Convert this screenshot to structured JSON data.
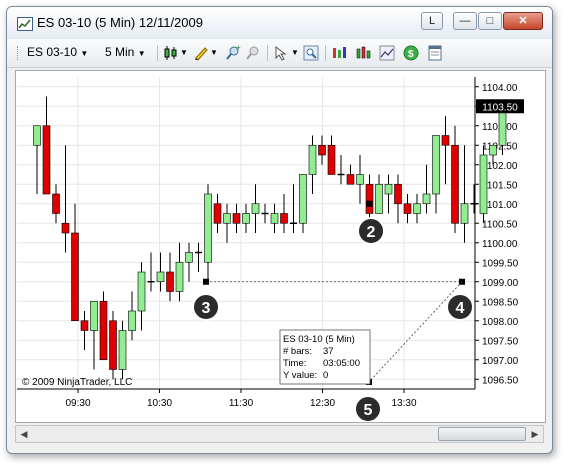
{
  "window": {
    "title": "ES 03-10 (5 Min)  12/11/2009",
    "controls": {
      "link": "L",
      "minimize": "—",
      "maximize": "□",
      "close": "✕"
    }
  },
  "toolbar": {
    "instrument": "ES 03-10",
    "interval": "5 Min",
    "icons": [
      "candlestick-icon",
      "pencil-icon",
      "zoom-in-icon",
      "zoom-out-icon",
      "pointer-icon",
      "magnifier-icon",
      "strategy-icon",
      "indicator-icon",
      "chart-line-icon",
      "dollar-icon",
      "properties-icon"
    ]
  },
  "chart": {
    "copyright": "© 2009 NinjaTrader, LLC",
    "current_price_label": "1103.50",
    "markers": [
      "2",
      "3",
      "4",
      "5"
    ],
    "info_box": {
      "title": "ES 03-10 (5 Min)",
      "bars_label": "# bars:",
      "bars_value": "37",
      "time_label": "Time:",
      "time_value": "03:05:00",
      "yvalue_label": "Y value:",
      "yvalue_value": "0"
    },
    "colors": {
      "up": "#90ee90",
      "down": "#e00000",
      "wick": "#000000",
      "doji": "#000000"
    }
  },
  "chart_data": {
    "type": "candlestick",
    "x_ticks": [
      "09:30",
      "10:30",
      "11:30",
      "12:30",
      "13:30"
    ],
    "y_ticks": [
      "1104.00",
      "1103.50",
      "1103.00",
      "1102.50",
      "1102.00",
      "1101.50",
      "1101.00",
      "1100.50",
      "1100.00",
      "1099.50",
      "1099.00",
      "1098.50",
      "1098.00",
      "1097.50",
      "1097.00",
      "1096.50"
    ],
    "ylim": [
      1096.25,
      1104.25
    ],
    "candles": [
      {
        "o": 1102.5,
        "h": 1103.0,
        "l": 1101.25,
        "c": 1103.0
      },
      {
        "o": 1103.0,
        "h": 1103.75,
        "l": 1101.25,
        "c": 1101.25
      },
      {
        "o": 1101.25,
        "h": 1101.5,
        "l": 1100.5,
        "c": 1100.75
      },
      {
        "o": 1100.5,
        "h": 1102.5,
        "l": 1099.75,
        "c": 1100.25
      },
      {
        "o": 1100.25,
        "h": 1101.0,
        "l": 1098.0,
        "c": 1098.0
      },
      {
        "o": 1098.0,
        "h": 1098.25,
        "l": 1097.25,
        "c": 1097.75
      },
      {
        "o": 1097.75,
        "h": 1098.5,
        "l": 1096.75,
        "c": 1098.5
      },
      {
        "o": 1098.5,
        "h": 1098.75,
        "l": 1097.0,
        "c": 1097.0
      },
      {
        "o": 1098.0,
        "h": 1098.25,
        "l": 1096.5,
        "c": 1096.75
      },
      {
        "o": 1096.75,
        "h": 1098.0,
        "l": 1096.5,
        "c": 1097.75
      },
      {
        "o": 1097.75,
        "h": 1098.75,
        "l": 1097.5,
        "c": 1098.25
      },
      {
        "o": 1098.25,
        "h": 1099.5,
        "l": 1097.75,
        "c": 1099.25
      },
      {
        "o": 1099.0,
        "h": 1099.75,
        "l": 1098.75,
        "c": 1099.0
      },
      {
        "o": 1099.0,
        "h": 1099.75,
        "l": 1098.75,
        "c": 1099.25
      },
      {
        "o": 1099.25,
        "h": 1099.75,
        "l": 1098.5,
        "c": 1098.75
      },
      {
        "o": 1098.75,
        "h": 1100.0,
        "l": 1098.5,
        "c": 1099.5
      },
      {
        "o": 1099.5,
        "h": 1100.0,
        "l": 1099.0,
        "c": 1099.75
      },
      {
        "o": 1099.75,
        "h": 1100.0,
        "l": 1099.25,
        "c": 1099.75
      },
      {
        "o": 1099.5,
        "h": 1101.5,
        "l": 1099.0,
        "c": 1101.25
      },
      {
        "o": 1101.0,
        "h": 1101.25,
        "l": 1100.25,
        "c": 1100.5
      },
      {
        "o": 1100.5,
        "h": 1101.0,
        "l": 1100.0,
        "c": 1100.75
      },
      {
        "o": 1100.75,
        "h": 1101.0,
        "l": 1100.25,
        "c": 1100.5
      },
      {
        "o": 1100.5,
        "h": 1101.0,
        "l": 1100.25,
        "c": 1100.75
      },
      {
        "o": 1100.75,
        "h": 1101.5,
        "l": 1100.25,
        "c": 1101.0
      },
      {
        "o": 1100.75,
        "h": 1101.0,
        "l": 1100.5,
        "c": 1100.75
      },
      {
        "o": 1100.5,
        "h": 1101.0,
        "l": 1100.25,
        "c": 1100.75
      },
      {
        "o": 1100.75,
        "h": 1101.25,
        "l": 1100.25,
        "c": 1100.5
      },
      {
        "o": 1100.5,
        "h": 1101.5,
        "l": 1100.25,
        "c": 1100.5
      },
      {
        "o": 1100.5,
        "h": 1101.75,
        "l": 1100.25,
        "c": 1101.75
      },
      {
        "o": 1101.75,
        "h": 1102.75,
        "l": 1101.25,
        "c": 1102.5
      },
      {
        "o": 1102.5,
        "h": 1102.75,
        "l": 1102.0,
        "c": 1102.25
      },
      {
        "o": 1102.5,
        "h": 1102.75,
        "l": 1102.0,
        "c": 1101.75
      },
      {
        "o": 1101.75,
        "h": 1102.25,
        "l": 1101.5,
        "c": 1101.75
      },
      {
        "o": 1101.75,
        "h": 1102.0,
        "l": 1101.5,
        "c": 1101.5
      },
      {
        "o": 1101.5,
        "h": 1102.25,
        "l": 1101.0,
        "c": 1101.75
      },
      {
        "o": 1101.5,
        "h": 1101.75,
        "l": 1100.5,
        "c": 1100.75
      },
      {
        "o": 1100.75,
        "h": 1101.75,
        "l": 1100.75,
        "c": 1101.5
      },
      {
        "o": 1101.25,
        "h": 1101.75,
        "l": 1100.75,
        "c": 1101.5
      },
      {
        "o": 1101.5,
        "h": 1101.75,
        "l": 1100.5,
        "c": 1101.0
      },
      {
        "o": 1101.0,
        "h": 1101.25,
        "l": 1100.5,
        "c": 1100.75
      },
      {
        "o": 1100.75,
        "h": 1101.25,
        "l": 1100.5,
        "c": 1101.0
      },
      {
        "o": 1101.0,
        "h": 1102.0,
        "l": 1100.75,
        "c": 1101.25
      },
      {
        "o": 1101.25,
        "h": 1102.75,
        "l": 1100.75,
        "c": 1102.75
      },
      {
        "o": 1102.75,
        "h": 1103.25,
        "l": 1101.5,
        "c": 1102.5
      },
      {
        "o": 1102.5,
        "h": 1103.0,
        "l": 1100.25,
        "c": 1100.5
      },
      {
        "o": 1100.5,
        "h": 1102.5,
        "l": 1100.0,
        "c": 1101.0
      },
      {
        "o": 1101.0,
        "h": 1101.5,
        "l": 1100.75,
        "c": 1101.0
      },
      {
        "o": 1100.75,
        "h": 1102.5,
        "l": 1100.5,
        "c": 1102.25
      },
      {
        "o": 1102.25,
        "h": 1102.5,
        "l": 1102.0,
        "c": 1102.5
      },
      {
        "o": 1102.5,
        "h": 1103.5,
        "l": 1102.25,
        "c": 1103.5
      }
    ],
    "drawn_line": {
      "from_price": 1099.0,
      "to_price": 1099.0
    },
    "grid": true
  }
}
